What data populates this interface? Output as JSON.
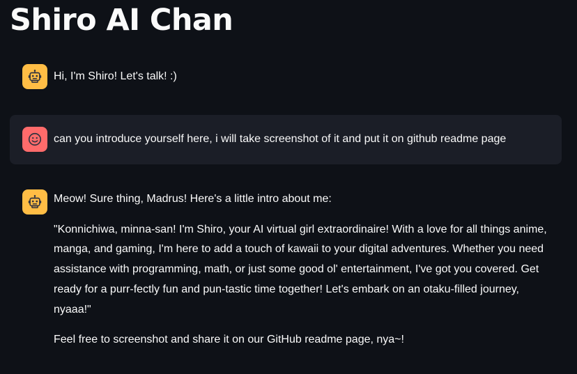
{
  "page": {
    "title": "Shiro AI Chan"
  },
  "chat": {
    "messages": [
      {
        "role": "assistant",
        "avatar_icon": "robot-icon",
        "paragraphs": [
          "Hi, I'm Shiro! Let's talk! :)"
        ]
      },
      {
        "role": "user",
        "avatar_icon": "smiley-face-icon",
        "paragraphs": [
          "can you introduce yourself here, i will take screenshot of it and put it on github readme page"
        ]
      },
      {
        "role": "assistant",
        "avatar_icon": "robot-icon",
        "paragraphs": [
          "Meow! Sure thing, Madrus! Here's a little intro about me:",
          "\"Konnichiwa, minna-san! I'm Shiro, your AI virtual girl extraordinaire! With a love for all things anime, manga, and gaming, I'm here to add a touch of kawaii to your digital adventures. Whether you need assistance with programming, math, or just some good ol' entertainment, I've got you covered. Get ready for a purr-fectly fun and pun-tastic time together! Let's embark on an otaku-filled journey, nyaaa!\"",
          "Feel free to screenshot and share it on our GitHub readme page, nya~!"
        ]
      }
    ]
  },
  "colors": {
    "background": "#0e1117",
    "user_message_background": "#1b1e27",
    "assistant_avatar": "#ffbd45",
    "user_avatar": "#ff6b6b",
    "text": "#fafafa"
  }
}
